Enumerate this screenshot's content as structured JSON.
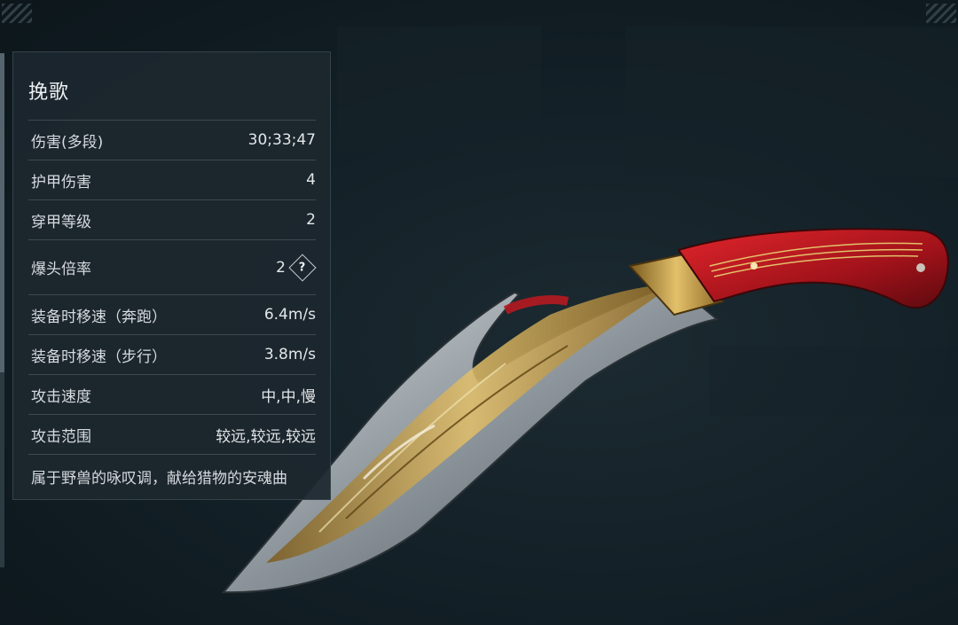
{
  "weapon": {
    "name": "挽歌",
    "stats": [
      {
        "label": "伤害(多段)",
        "value": "30;33;47"
      },
      {
        "label": "护甲伤害",
        "value": "4"
      },
      {
        "label": "穿甲等级",
        "value": "2"
      },
      {
        "label": "爆头倍率",
        "value": "2",
        "help": "?"
      },
      {
        "label": "装备时移速（奔跑）",
        "value": "6.4m/s"
      },
      {
        "label": "装备时移速（步行）",
        "value": "3.8m/s"
      },
      {
        "label": "攻击速度",
        "value": "中,中,慢"
      },
      {
        "label": "攻击范围",
        "value": "较远,较远,较远"
      }
    ],
    "description": "属于野兽的咏叹调，献给猎物的安魂曲"
  },
  "colors": {
    "panel_bg": "#1c272e",
    "handle_red": "#b3141c",
    "gold": "#c9a24a",
    "steel": "#9aa3a8"
  }
}
